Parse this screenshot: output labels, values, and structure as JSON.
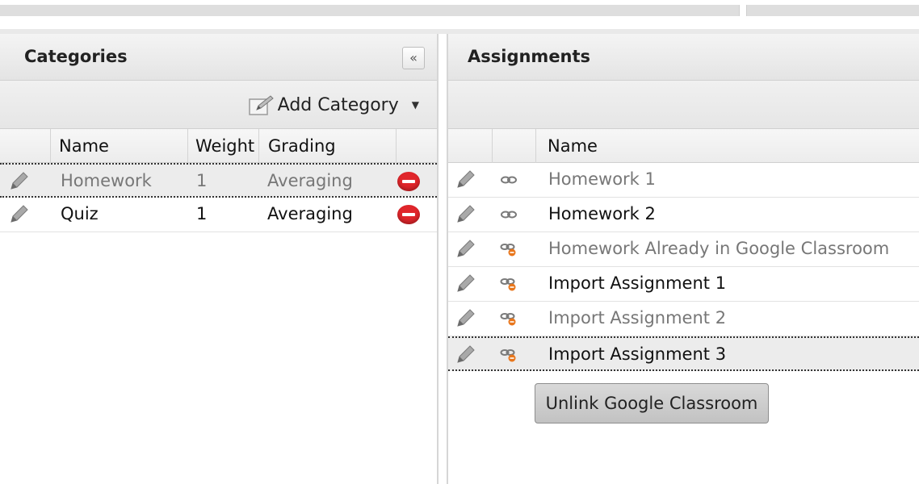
{
  "categories_panel": {
    "title": "Categories",
    "collapse_label": "«",
    "add_category_label": "Add Category",
    "columns": [
      "Name",
      "Weight",
      "Grading"
    ],
    "rows": [
      {
        "name": "Homework",
        "weight": "1",
        "grading": "Averaging",
        "selected": true
      },
      {
        "name": "Quiz",
        "weight": "1",
        "grading": "Averaging",
        "selected": false
      }
    ]
  },
  "assignments_panel": {
    "title": "Assignments",
    "columns": [
      "Name"
    ],
    "rows": [
      {
        "name": "Homework 1",
        "link_icon": "link-icon",
        "muted": true
      },
      {
        "name": "Homework 2",
        "link_icon": "link-icon",
        "muted": false
      },
      {
        "name": "Homework Already in Google Classroom",
        "link_icon": "link-warning-icon",
        "muted": true
      },
      {
        "name": "Import Assignment 1",
        "link_icon": "link-warning-icon",
        "muted": false
      },
      {
        "name": "Import Assignment 2",
        "link_icon": "link-warning-icon",
        "muted": true
      },
      {
        "name": "Import Assignment 3",
        "link_icon": "link-warning-icon",
        "muted": false,
        "selected": true
      }
    ],
    "unlink_button_label": "Unlink Google Classroom"
  },
  "colors": {
    "delete_red": "#e0262b",
    "warning_orange": "#e8761c",
    "muted_text": "#777777"
  }
}
